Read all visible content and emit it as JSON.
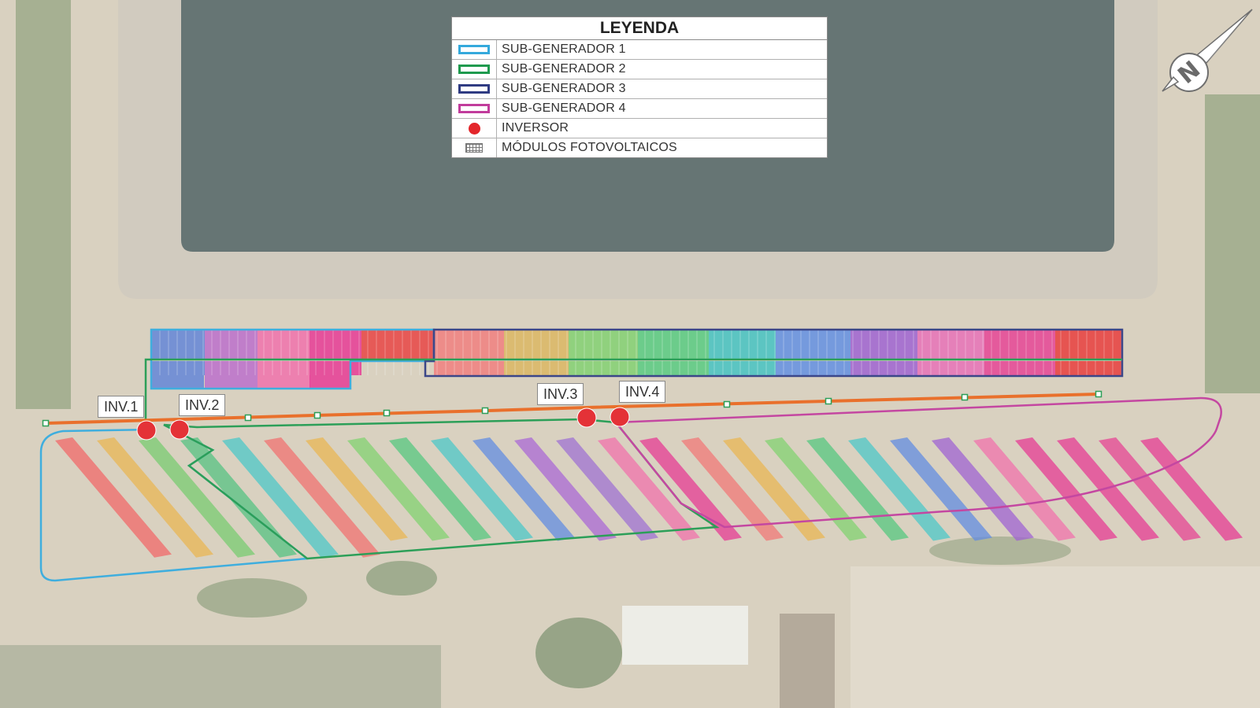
{
  "legend": {
    "title": "LEYENDA",
    "items": [
      {
        "label": "SUB-GENERADOR 1",
        "symbol": "box",
        "color": "#34a9dc"
      },
      {
        "label": "SUB-GENERADOR 2",
        "symbol": "box",
        "color": "#1f9a4e"
      },
      {
        "label": "SUB-GENERADOR 3",
        "symbol": "box",
        "color": "#2f3b82"
      },
      {
        "label": "SUB-GENERADOR 4",
        "symbol": "box",
        "color": "#c13c9c"
      },
      {
        "label": "INVERSOR",
        "symbol": "dot",
        "color": "#e3262b"
      },
      {
        "label": "MÓDULOS FOTOVOLTAICOS",
        "symbol": "grid",
        "color": "#777777"
      }
    ]
  },
  "inverters": [
    {
      "label": "INV.1"
    },
    {
      "label": "INV.2"
    },
    {
      "label": "INV.3"
    },
    {
      "label": "INV.4"
    }
  ],
  "north_arrow": {
    "letter": "N",
    "icon": "north-arrow-icon"
  },
  "colors": {
    "sub1": "#34a9dc",
    "sub2": "#1f9a4e",
    "sub3": "#2f3b82",
    "sub4": "#c13c9c",
    "inverter": "#e3262b",
    "cable": "#e8681f",
    "water": "#596a69"
  }
}
